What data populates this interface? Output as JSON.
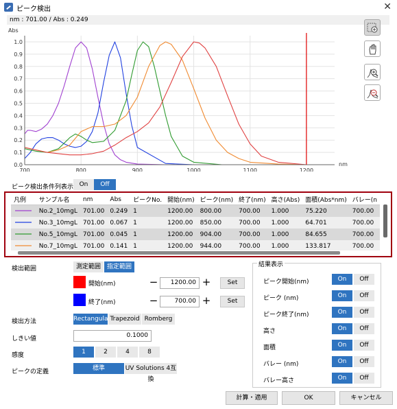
{
  "window": {
    "title": "ピーク検出"
  },
  "readout": "nm : 701.00  /  Abs : 0.249",
  "chart_data": {
    "type": "line",
    "ylabel": "Abs",
    "xlabel": "nm",
    "xlim": [
      700,
      1250
    ],
    "ylim": [
      0,
      1.05
    ],
    "x_ticks": [
      "700",
      "800",
      "900",
      "1000",
      "1100",
      "1200"
    ],
    "y_ticks": [
      "0.0",
      "0.1",
      "0.2",
      "0.3",
      "0.4",
      "0.5",
      "0.6",
      "0.7",
      "0.8",
      "0.9",
      "1.0"
    ],
    "cursor_x": 1200,
    "series": [
      {
        "name": "No.2_10mgL",
        "color": "#a040d0",
        "x": [
          700,
          705,
          710,
          720,
          730,
          740,
          750,
          760,
          770,
          780,
          790,
          800,
          810,
          820,
          830,
          840,
          850,
          860,
          870,
          880,
          900,
          950,
          1000,
          1100,
          1200
        ],
        "y": [
          0.25,
          0.28,
          0.28,
          0.27,
          0.29,
          0.33,
          0.4,
          0.5,
          0.64,
          0.8,
          0.95,
          1.0,
          0.95,
          0.78,
          0.55,
          0.33,
          0.17,
          0.08,
          0.04,
          0.02,
          0.005,
          0,
          0,
          0,
          0
        ]
      },
      {
        "name": "No.3_10mgL",
        "color": "#2040e0",
        "x": [
          700,
          710,
          720,
          730,
          740,
          750,
          760,
          770,
          780,
          790,
          800,
          810,
          820,
          830,
          840,
          850,
          860,
          870,
          880,
          890,
          900,
          950,
          1000,
          1100,
          1200
        ],
        "y": [
          0.05,
          0.1,
          0.17,
          0.21,
          0.22,
          0.22,
          0.2,
          0.17,
          0.15,
          0.14,
          0.15,
          0.19,
          0.27,
          0.42,
          0.67,
          0.89,
          1.0,
          0.87,
          0.58,
          0.32,
          0.14,
          0.01,
          0,
          0,
          0
        ]
      },
      {
        "name": "No.5_10mgL",
        "color": "#2e9a2e",
        "x": [
          700,
          720,
          740,
          760,
          780,
          790,
          800,
          810,
          820,
          840,
          860,
          880,
          890,
          900,
          910,
          920,
          930,
          940,
          950,
          960,
          980,
          1000,
          1050,
          1100,
          1200
        ],
        "y": [
          0.13,
          0.11,
          0.1,
          0.13,
          0.22,
          0.25,
          0.23,
          0.2,
          0.18,
          0.19,
          0.28,
          0.52,
          0.73,
          0.93,
          1.0,
          0.96,
          0.8,
          0.6,
          0.4,
          0.23,
          0.07,
          0.02,
          0,
          0,
          0
        ]
      },
      {
        "name": "No.7_10mgL",
        "color": "#f08a30",
        "x": [
          700,
          720,
          740,
          760,
          780,
          800,
          820,
          840,
          860,
          880,
          900,
          920,
          940,
          950,
          960,
          980,
          1000,
          1020,
          1040,
          1060,
          1080,
          1100,
          1150,
          1200
        ],
        "y": [
          0.14,
          0.12,
          0.1,
          0.12,
          0.16,
          0.27,
          0.31,
          0.31,
          0.33,
          0.4,
          0.55,
          0.8,
          0.97,
          1.0,
          0.98,
          0.85,
          0.62,
          0.38,
          0.2,
          0.1,
          0.05,
          0.02,
          0.005,
          0
        ]
      },
      {
        "name": "",
        "color": "#e04040",
        "x": [
          700,
          720,
          740,
          760,
          780,
          800,
          820,
          840,
          860,
          880,
          900,
          920,
          940,
          960,
          980,
          1000,
          1010,
          1020,
          1040,
          1060,
          1080,
          1100,
          1120,
          1150,
          1200
        ],
        "y": [
          0.14,
          0.12,
          0.1,
          0.09,
          0.08,
          0.08,
          0.09,
          0.11,
          0.16,
          0.22,
          0.27,
          0.34,
          0.47,
          0.67,
          0.88,
          1.0,
          0.99,
          0.95,
          0.8,
          0.56,
          0.33,
          0.17,
          0.07,
          0.02,
          0
        ]
      }
    ]
  },
  "tools": [
    {
      "name": "zoom-area-icon",
      "selected": true
    },
    {
      "name": "pan-hand-icon",
      "selected": false
    },
    {
      "name": "zoom-in-icon",
      "selected": false
    },
    {
      "name": "zoom-out-icon",
      "selected": false
    }
  ],
  "condition_list": {
    "label": "ピーク検出条件列表示",
    "on": "On",
    "off": "Off",
    "value": "Off"
  },
  "table": {
    "headers": [
      "凡例",
      "サンプル名",
      "nm",
      "Abs",
      "ピークNo.",
      "開始(nm)",
      "ピーク(nm)",
      "終了(nm)",
      "高さ(Abs)",
      "面積(Abs*nm)",
      "バレー(n"
    ],
    "rows": [
      {
        "color": "#a040d0",
        "cells": [
          "No.2_10mgL",
          "701.00",
          "0.249",
          "1",
          "1200.00",
          "800.00",
          "700.00",
          "1.000",
          "75.220",
          "700.00"
        ]
      },
      {
        "color": "#2040e0",
        "cells": [
          "No.3_10mgL",
          "701.00",
          "0.067",
          "1",
          "1200.00",
          "850.00",
          "700.00",
          "1.000",
          "64.701",
          "700.00"
        ]
      },
      {
        "color": "#2e9a2e",
        "cells": [
          "No.5_10mgL",
          "701.00",
          "0.045",
          "1",
          "1200.00",
          "904.00",
          "700.00",
          "1.000",
          "84.655",
          "700.00"
        ]
      },
      {
        "color": "#f08a30",
        "cells": [
          "No.7_10mgL",
          "701.00",
          "0.141",
          "1",
          "1200.00",
          "944.00",
          "700.00",
          "1.000",
          "133.817",
          "700.00"
        ]
      }
    ]
  },
  "detection_range": {
    "label": "検出範囲",
    "options": [
      "測定範囲",
      "指定範囲"
    ],
    "selected": "指定範囲",
    "start_label": "開始(nm)",
    "start_value": "1200.00",
    "start_color": "#ff0000",
    "end_label": "終了(nm)",
    "end_value": "700.00",
    "end_color": "#0000ff",
    "set_label": "Set",
    "minus": "−",
    "plus": "+"
  },
  "method": {
    "label": "検出方法",
    "options": [
      "Rectangular",
      "Trapezoid",
      "Romberg"
    ],
    "selected": "Rectangular"
  },
  "threshold": {
    "label": "しきい値",
    "value": "0.1000"
  },
  "sensitivity": {
    "label": "感度",
    "options": [
      "1",
      "2",
      "4",
      "8"
    ],
    "selected": "1"
  },
  "peak_def": {
    "label": "ピークの定義",
    "options": [
      "標準",
      "UV Solutions 4互換"
    ],
    "selected": "標準"
  },
  "result": {
    "title": "結果表示",
    "on": "On",
    "off": "Off",
    "items": [
      {
        "label": "ピーク開始(nm)",
        "value": "On"
      },
      {
        "label": "ピーク (nm)",
        "value": "On"
      },
      {
        "label": "ピーク終了(nm)",
        "value": "On"
      },
      {
        "label": "高さ",
        "value": "On"
      },
      {
        "label": "面積",
        "value": "On"
      },
      {
        "label": "バレー (nm)",
        "value": "On"
      },
      {
        "label": "バレー高さ",
        "value": "On"
      }
    ]
  },
  "footer": {
    "apply": "計算・適用",
    "ok": "OK",
    "cancel": "キャンセル"
  }
}
